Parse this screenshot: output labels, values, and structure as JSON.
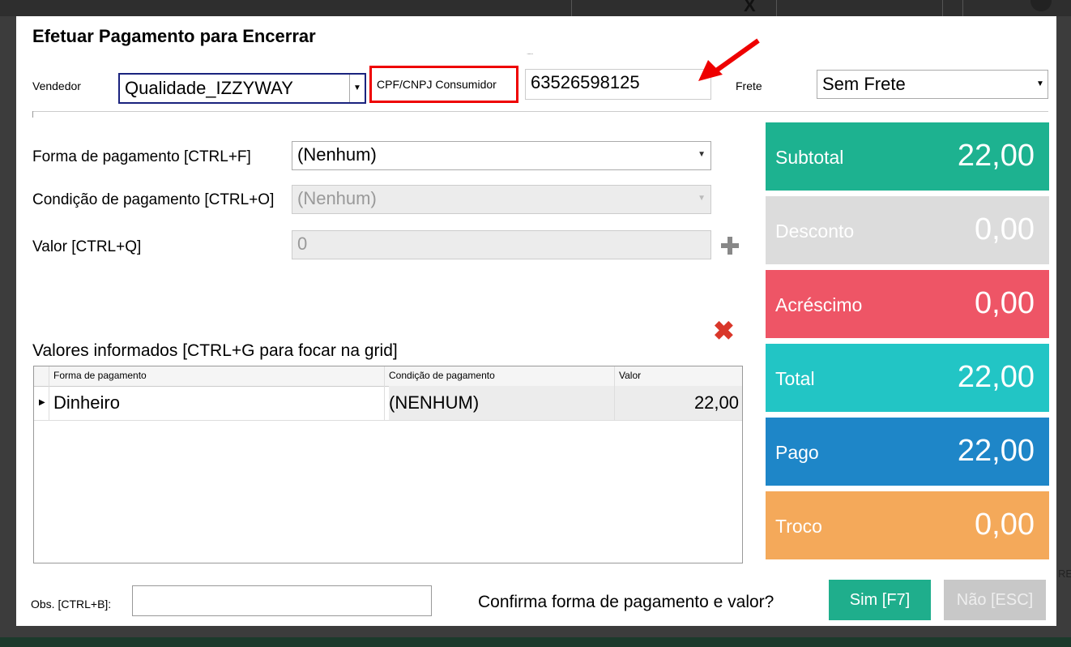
{
  "dialog": {
    "title": "Efetuar Pagamento para Encerrar",
    "dots": "......"
  },
  "header": {
    "vendedor_label": "Vendedor",
    "vendedor_value": "Qualidade_IZZYWAY",
    "cpf_label": "CPF/CNPJ Consumidor",
    "cpf_value": "63526598125",
    "frete_label": "Frete",
    "frete_value": "Sem Frete"
  },
  "form": {
    "forma_label": "Forma de pagamento [CTRL+F]",
    "forma_value": "(Nenhum)",
    "condicao_label": "Condição de pagamento [CTRL+O]",
    "condicao_value": "(Nenhum)",
    "valor_label": "Valor [CTRL+Q]",
    "valor_value": "0"
  },
  "grid": {
    "title": "Valores informados [CTRL+G para focar na grid]",
    "columns": [
      "Forma de pagamento",
      "Condição de pagamento",
      "Valor"
    ],
    "rows": [
      {
        "forma": "Dinheiro",
        "condicao": "(NENHUM)",
        "valor": "22,00"
      }
    ]
  },
  "summary": {
    "tiles": [
      {
        "label": "Subtotal",
        "value": "22,00",
        "color": "#1db290"
      },
      {
        "label": "Desconto",
        "value": "0,00",
        "color": "#dcdcdc"
      },
      {
        "label": "Acréscimo",
        "value": "0,00",
        "color": "#ee5566"
      },
      {
        "label": "Total",
        "value": "22,00",
        "color": "#22c5c5"
      },
      {
        "label": "Pago",
        "value": "22,00",
        "color": "#1e86c8"
      },
      {
        "label": "Troco",
        "value": "0,00",
        "color": "#f4a95a"
      }
    ]
  },
  "footer": {
    "obs_label": "Obs. [CTRL+B]:",
    "obs_value": "",
    "confirm_text": "Confirma forma de pagamento e valor?",
    "yes_label": "Sim [F7]",
    "no_label": "Não [ESC]"
  },
  "background": {
    "x_glyph": "X",
    "right_text": "RE"
  }
}
